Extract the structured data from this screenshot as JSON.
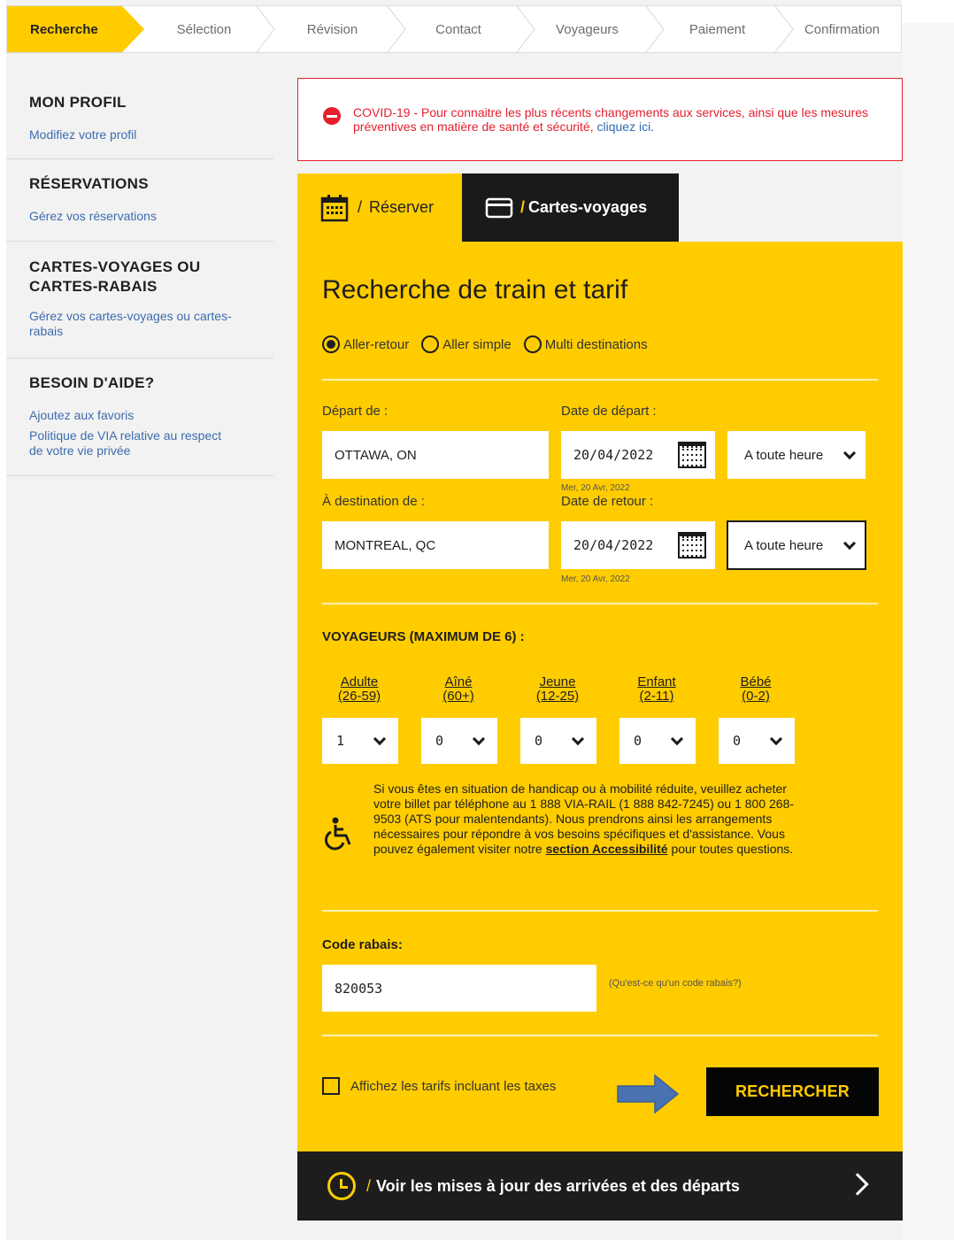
{
  "steps": [
    "Recherche",
    "Sélection",
    "Révision",
    "Contact",
    "Voyageurs",
    "Paiement",
    "Confirmation"
  ],
  "sidebar": {
    "sections": [
      {
        "title": "MON PROFIL",
        "links": [
          "Modifiez votre profil"
        ]
      },
      {
        "title": "RÉSERVATIONS",
        "links": [
          "Gérez vos réservations"
        ]
      },
      {
        "title": "CARTES-VOYAGES OU CARTES-RABAIS",
        "links": [
          "Gérez vos cartes-voyages ou cartes-rabais"
        ]
      },
      {
        "title": "BESOIN D'AIDE?",
        "links": [
          "Ajoutez aux favoris",
          "Politique de VIA relative au respect de votre vie privée"
        ]
      }
    ]
  },
  "alert": {
    "text": "COVID-19 - Pour connaitre les plus récents changements aux services, ainsi que les mesures préventives en matière de santé et sécurité,",
    "link": "cliquez ici."
  },
  "tabs": {
    "book": "Réserver",
    "pass": "Cartes-voyages",
    "slash": "/"
  },
  "form": {
    "title": "Recherche de train et tarif",
    "trip_types": [
      "Aller-retour",
      "Aller simple",
      "Multi destinations"
    ],
    "selected_trip_type": "Aller-retour",
    "from_label": "Départ de :",
    "from_value": "OTTAWA, ON",
    "depart_date_label": "Date de départ :",
    "depart_date": "20/04/2022",
    "depart_date_sub": "Mer, 20 Avr, 2022",
    "depart_time": "A toute heure",
    "to_label": "À destination de :",
    "to_value": "MONTREAL, QC",
    "return_date_label": "Date de retour :",
    "return_date": "20/04/2022",
    "return_date_sub": "Mer, 20 Avr, 2022",
    "return_time": "A toute heure",
    "travellers_title": "VOYAGEURS (MAXIMUM DE 6) :",
    "passengers": [
      {
        "label1": "Adulte",
        "label2": "(26-59)",
        "value": "1"
      },
      {
        "label1": "Aîné",
        "label2": "(60+)",
        "value": "0"
      },
      {
        "label1": "Jeune",
        "label2": "(12-25)",
        "value": "0"
      },
      {
        "label1": "Enfant",
        "label2": "(2-11)",
        "value": "0"
      },
      {
        "label1": "Bébé",
        "label2": "(0-2)",
        "value": "0"
      }
    ],
    "accessibility_text": "Si vous êtes en situation de handicap ou à mobilité réduite, veuillez acheter votre billet par téléphone au 1 888 VIA-RAIL (1 888 842-7245) ou 1 800 268-9503 (ATS pour malentendants). Nous prendrons ainsi les arrangements nécessaires pour répondre à vos besoins spécifiques et d'assistance. Vous pouvez également visiter notre",
    "accessibility_link": "section Accessibilité",
    "accessibility_tail": "pour toutes questions.",
    "promo_label": "Code rabais:",
    "promo_value": "820053",
    "promo_help": "(Qu'est-ce qu'un code rabais?)",
    "taxes_label": "Affichez les tarifs incluant les taxes",
    "search_button": "RECHERCHER"
  },
  "updates_bar": {
    "text": "Voir les mises à jour des arrivées et des départs",
    "slash": "/"
  },
  "colors": {
    "accent": "#ffcc00",
    "dark": "#1a1a1a",
    "alert": "#e4202e",
    "link": "#3c6cae",
    "arrow": "#4b72b0"
  },
  "icons": [
    "calendar-icon",
    "card-icon",
    "calendar-icon",
    "wheelchair-icon",
    "clock-icon",
    "chevron-right-icon",
    "alert-icon",
    "arrow-right-icon"
  ]
}
